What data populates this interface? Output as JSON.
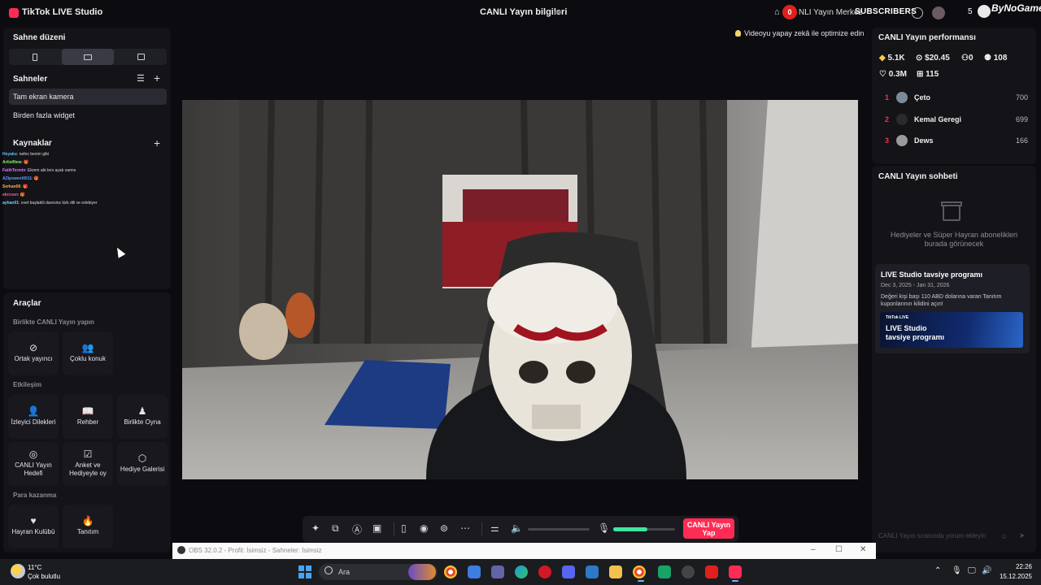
{
  "app": {
    "title": "TikTok LIVE Studio",
    "live_info": "CANLI Yayın bilgileri",
    "notification_count": "0",
    "center_link": "NLI Yayın Merkez",
    "subscribers_label": "SUBSCRIBERS",
    "subscriber_count": "5",
    "brand": "ByNoGame"
  },
  "left": {
    "scene_layout_title": "Sahne düzeni",
    "scenes_title": "Sahneler",
    "scenes": [
      "Tam ekran kamera",
      "Birden fazla widget"
    ],
    "sources_title": "Kaynaklar",
    "chat_overlay": [
      {
        "user": "Heyaku",
        "text": "nefes benim gibi"
      },
      {
        "user": "ArtistNew",
        "text": "🎁"
      },
      {
        "user": "FatihTermin",
        "text": "Ekrem abi ters ayak varms"
      },
      {
        "user": "AZipswent0011",
        "text": "🎁"
      },
      {
        "user": "Serkan06",
        "text": "🎁"
      },
      {
        "user": "ekrcsen",
        "text": "🎁"
      },
      {
        "user": "ayhan01",
        "text": "ovet başlaktli daresinz türk dili ve edebiyer"
      }
    ],
    "tools_title": "Araçlar",
    "groups": [
      {
        "title": "Birlikte CANLI Yayın yapın",
        "items": [
          "Ortak yayıncı",
          "Çoklu konuk"
        ]
      },
      {
        "title": "Etkileşim",
        "items": [
          "İzleyici Dilekleri",
          "Rehber",
          "Birlikte Oyna",
          "CANLI Yayın Hedefi",
          "Anket ve Hediyeyle oy",
          "Hediye Galerisi"
        ]
      },
      {
        "title": "Para kazanma",
        "items": [
          "Hayran Kulübü",
          "Tanıtım"
        ]
      }
    ]
  },
  "preview": {
    "ai_tip": "Videoyu yapay zekâ ile optimize edin"
  },
  "right": {
    "perf_title": "CANLI Yayın performansı",
    "stats": {
      "diamonds": "5.1K",
      "earnings": "$20.45",
      "viewers": "0",
      "followers": "108",
      "likes": "0.3M",
      "gifts": "115"
    },
    "ranking": [
      {
        "rank": "1",
        "name": "Çeto",
        "score": "700"
      },
      {
        "rank": "2",
        "name": "Kemal Geregi",
        "score": "699"
      },
      {
        "rank": "3",
        "name": "Dews",
        "score": "166"
      }
    ],
    "chat_title": "CANLI Yayın sohbeti",
    "gifts_placeholder": "Hediyeler ve Süper Hayran abonelikleri burada görünecek",
    "promo": {
      "title": "LIVE Studio tavsiye programı",
      "dates": "Dec 3, 2025 - Jan 31, 2026",
      "desc": "Değeri kişi başı 110 ABD dolarına varan Tanıtım kuponlarının kilidini açın!",
      "banner_brand": "TikTok LIVE",
      "banner_title": "LIVE Studio tavsiye programı"
    },
    "comment_placeholder": "CANLI Yayın sırasında yorum ekleyin"
  },
  "toolbar": {
    "go_live": "CANLI Yayın Yap",
    "volume_level": 0,
    "mic_level": 0.55
  },
  "obs": {
    "title": "OBS 32.0.2 - Profil: İsimsiz - Sahneler: İsimsiz"
  },
  "taskbar": {
    "temperature": "11°C",
    "weather": "Çok bulutlu",
    "search_placeholder": "Ara",
    "time": "22:26",
    "date": "15.12.2025"
  }
}
